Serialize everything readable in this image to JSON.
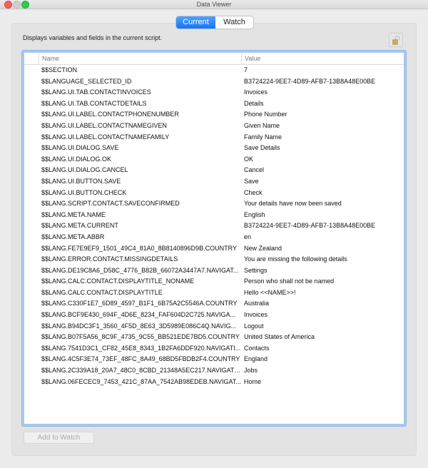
{
  "window": {
    "title": "Data Viewer"
  },
  "tabs": [
    {
      "label": "Current",
      "active": true
    },
    {
      "label": "Watch",
      "active": false
    }
  ],
  "description": "Displays variables and fields in the current script.",
  "lock_icon": "unlocked-padlock-icon",
  "table": {
    "columns": {
      "name": "Name",
      "value": "Value"
    },
    "rows": [
      {
        "name": "$$SECTION",
        "value": "7"
      },
      {
        "name": "$$LANGUAGE_SELECTED_ID",
        "value": "B3724224-9EE7-4D89-AFB7-13B8A48E00BE"
      },
      {
        "name": "$$LANG.UI.TAB.CONTACTINVOICES",
        "value": "Invoices"
      },
      {
        "name": "$$LANG.UI.TAB.CONTACTDETAILS",
        "value": "Details"
      },
      {
        "name": "$$LANG.UI.LABEL.CONTACTPHONENUMBER",
        "value": "Phone Number"
      },
      {
        "name": "$$LANG.UI.LABEL.CONTACTNAMEGIVEN",
        "value": "Given Name"
      },
      {
        "name": "$$LANG.UI.LABEL.CONTACTNAMEFAMILY",
        "value": "Family Name"
      },
      {
        "name": "$$LANG.UI.DIALOG.SAVE",
        "value": "Save Details"
      },
      {
        "name": "$$LANG.UI.DIALOG.OK",
        "value": "OK"
      },
      {
        "name": "$$LANG.UI.DIALOG.CANCEL",
        "value": "Cancel"
      },
      {
        "name": "$$LANG.UI.BUTTON.SAVE",
        "value": "Save"
      },
      {
        "name": "$$LANG.UI.BUTTON.CHECK",
        "value": "Check"
      },
      {
        "name": "$$LANG.SCRIPT.CONTACT.SAVECONFIRMED",
        "value": "Your details have now been saved"
      },
      {
        "name": "$$LANG.META.NAME",
        "value": "English"
      },
      {
        "name": "$$LANG.META.CURRENT",
        "value": "B3724224-9EE7-4D89-AFB7-13B8A48E00BE"
      },
      {
        "name": "$$LANG.META.ABBR",
        "value": "en"
      },
      {
        "name": "$$LANG.FE7E9EF9_1501_49C4_81A0_8B8140896D9B.COUNTRY",
        "value": "New Zealand"
      },
      {
        "name": "$$LANG.ERROR.CONTACT.MISSINGDETAILS",
        "value": "You are missing the following details"
      },
      {
        "name": "$$LANG.DE19C8A6_D58C_4776_B82B_66072A3447A7.NAVIGAT...",
        "value": "Settings"
      },
      {
        "name": "$$LANG.CALC.CONTACT.DISPLAYTITLE_NONAME",
        "value": "Person who shall not be named"
      },
      {
        "name": "$$LANG.CALC.CONTACT.DISPLAYTITLE",
        "value": "Hello <<NAME>>!"
      },
      {
        "name": "$$LANG.C330F1E7_6D89_4597_B1F1_6B75A2C5546A.COUNTRY",
        "value": "Australia"
      },
      {
        "name": "$$LANG.BCF9E430_694F_4D6E_8234_FAF604D2C725.NAVIGA...",
        "value": "Invoices"
      },
      {
        "name": "$$LANG.B94DC3F1_3560_4F5D_8E63_3D5989E086C4Q.NAVIG...",
        "value": "Logout"
      },
      {
        "name": "$$LANG.B07F5A56_8C9F_4735_9C55_BB521EDE7BD5.COUNTRY",
        "value": "United States of America"
      },
      {
        "name": "$$LANG.7541D3C1_CF82_45E8_8343_1B2FA6DDF920.NAVIGATI...",
        "value": "Contacts"
      },
      {
        "name": "$$LANG.4C5F3E74_73EF_48FC_8A49_68BD5FBDB2F4.COUNTRY",
        "value": "England"
      },
      {
        "name": "$$LANG.2C339A18_20A7_48C0_8CBD_21348A5EC217.NAVIGATI...",
        "value": "Jobs"
      },
      {
        "name": "$$LANG.06FECEC9_7453_421C_87AA_7542AB98EDEB.NAVIGAT...",
        "value": "Home"
      }
    ]
  },
  "buttons": {
    "add_to_watch": "Add to Watch"
  },
  "colors": {
    "accent": "#1673f5",
    "focus_ring": "#a9c8ef",
    "close": "#fc605c",
    "maximize": "#34c84a"
  }
}
